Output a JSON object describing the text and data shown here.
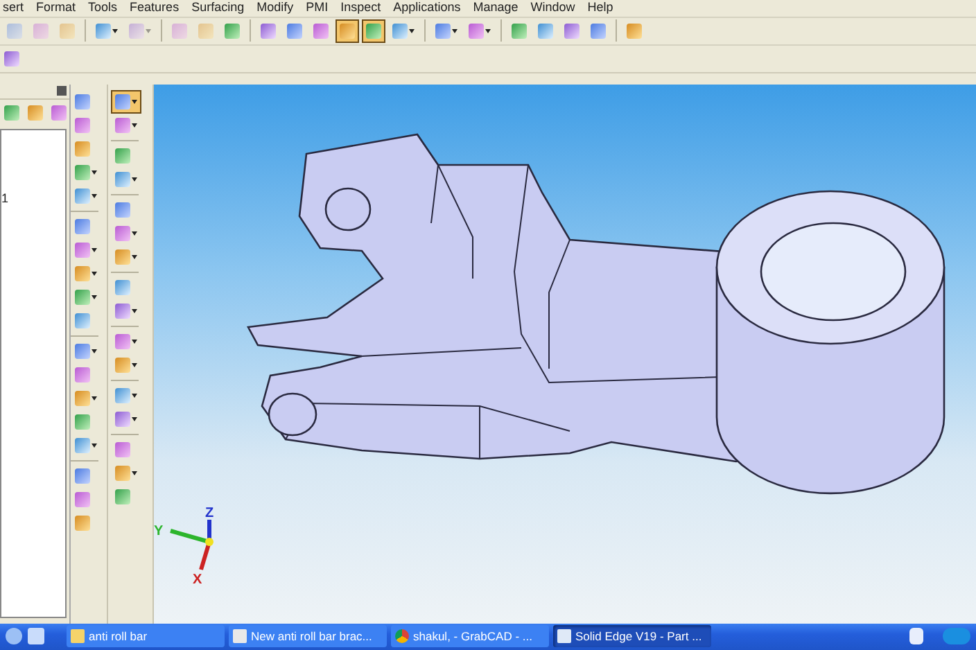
{
  "menu": [
    {
      "label": "sert"
    },
    {
      "label": "Format"
    },
    {
      "label": "Tools"
    },
    {
      "label": "Features"
    },
    {
      "label": "Surfacing"
    },
    {
      "label": "Modify"
    },
    {
      "label": "PMI"
    },
    {
      "label": "Inspect"
    },
    {
      "label": "Applications"
    },
    {
      "label": "Manage"
    },
    {
      "label": "Window"
    },
    {
      "label": "Help"
    }
  ],
  "toolbar": [
    {
      "kind": "button",
      "pressed": false,
      "disabled": true
    },
    {
      "kind": "button",
      "pressed": false,
      "disabled": true
    },
    {
      "kind": "button",
      "pressed": false,
      "disabled": true
    },
    {
      "kind": "sep"
    },
    {
      "kind": "split",
      "pressed": false,
      "disabled": false
    },
    {
      "kind": "split",
      "pressed": false,
      "disabled": true
    },
    {
      "kind": "sep"
    },
    {
      "kind": "button",
      "pressed": false,
      "disabled": true
    },
    {
      "kind": "button",
      "pressed": false,
      "disabled": true
    },
    {
      "kind": "button",
      "pressed": false,
      "disabled": false
    },
    {
      "kind": "sep"
    },
    {
      "kind": "button",
      "pressed": false,
      "disabled": false
    },
    {
      "kind": "button",
      "pressed": false,
      "disabled": false
    },
    {
      "kind": "button",
      "pressed": false,
      "disabled": false
    },
    {
      "kind": "button",
      "pressed": true,
      "disabled": false
    },
    {
      "kind": "button",
      "pressed": true,
      "disabled": false
    },
    {
      "kind": "split",
      "pressed": false,
      "disabled": false
    },
    {
      "kind": "sep"
    },
    {
      "kind": "split",
      "pressed": false,
      "disabled": false
    },
    {
      "kind": "split",
      "pressed": false,
      "disabled": false
    },
    {
      "kind": "sep"
    },
    {
      "kind": "button",
      "pressed": false,
      "disabled": false
    },
    {
      "kind": "button",
      "pressed": false,
      "disabled": false
    },
    {
      "kind": "button",
      "pressed": false,
      "disabled": false
    },
    {
      "kind": "button",
      "pressed": false,
      "disabled": false
    },
    {
      "kind": "sep"
    },
    {
      "kind": "button",
      "pressed": false,
      "disabled": false
    }
  ],
  "panel": {
    "tree_items": [
      {
        "label": "1"
      }
    ]
  },
  "features_column": [
    {
      "kind": "button"
    },
    {
      "kind": "button"
    },
    {
      "kind": "button"
    },
    {
      "kind": "split"
    },
    {
      "kind": "split"
    },
    {
      "kind": "sep"
    },
    {
      "kind": "button"
    },
    {
      "kind": "split"
    },
    {
      "kind": "split"
    },
    {
      "kind": "split"
    },
    {
      "kind": "button"
    },
    {
      "kind": "sep"
    },
    {
      "kind": "split"
    },
    {
      "kind": "button"
    },
    {
      "kind": "split"
    },
    {
      "kind": "button"
    },
    {
      "kind": "split"
    },
    {
      "kind": "sep"
    },
    {
      "kind": "button"
    },
    {
      "kind": "button"
    },
    {
      "kind": "button"
    }
  ],
  "tools_column": [
    {
      "kind": "split",
      "pressed": true
    },
    {
      "kind": "split",
      "pressed": false
    },
    {
      "kind": "sep"
    },
    {
      "kind": "button",
      "pressed": false
    },
    {
      "kind": "split",
      "pressed": false
    },
    {
      "kind": "sep"
    },
    {
      "kind": "button",
      "pressed": false
    },
    {
      "kind": "split",
      "pressed": false
    },
    {
      "kind": "split",
      "pressed": false
    },
    {
      "kind": "sep"
    },
    {
      "kind": "button",
      "pressed": false
    },
    {
      "kind": "split",
      "pressed": false
    },
    {
      "kind": "sep"
    },
    {
      "kind": "split",
      "pressed": false
    },
    {
      "kind": "split",
      "pressed": false
    },
    {
      "kind": "sep"
    },
    {
      "kind": "split",
      "pressed": false
    },
    {
      "kind": "split",
      "pressed": false
    },
    {
      "kind": "sep"
    },
    {
      "kind": "button",
      "pressed": false
    },
    {
      "kind": "split",
      "pressed": false
    },
    {
      "kind": "button",
      "pressed": false
    }
  ],
  "viewport": {
    "triad": {
      "x_label": "X",
      "y_label": "Y",
      "z_label": "Z"
    }
  },
  "taskbar": {
    "tasks": [
      {
        "label": "anti roll bar",
        "selected": false
      },
      {
        "label": "New anti roll bar brac...",
        "selected": false
      },
      {
        "label": "shakul, - GrabCAD - ...",
        "selected": false
      },
      {
        "label": "Solid Edge V19 - Part ...",
        "selected": true
      }
    ]
  }
}
